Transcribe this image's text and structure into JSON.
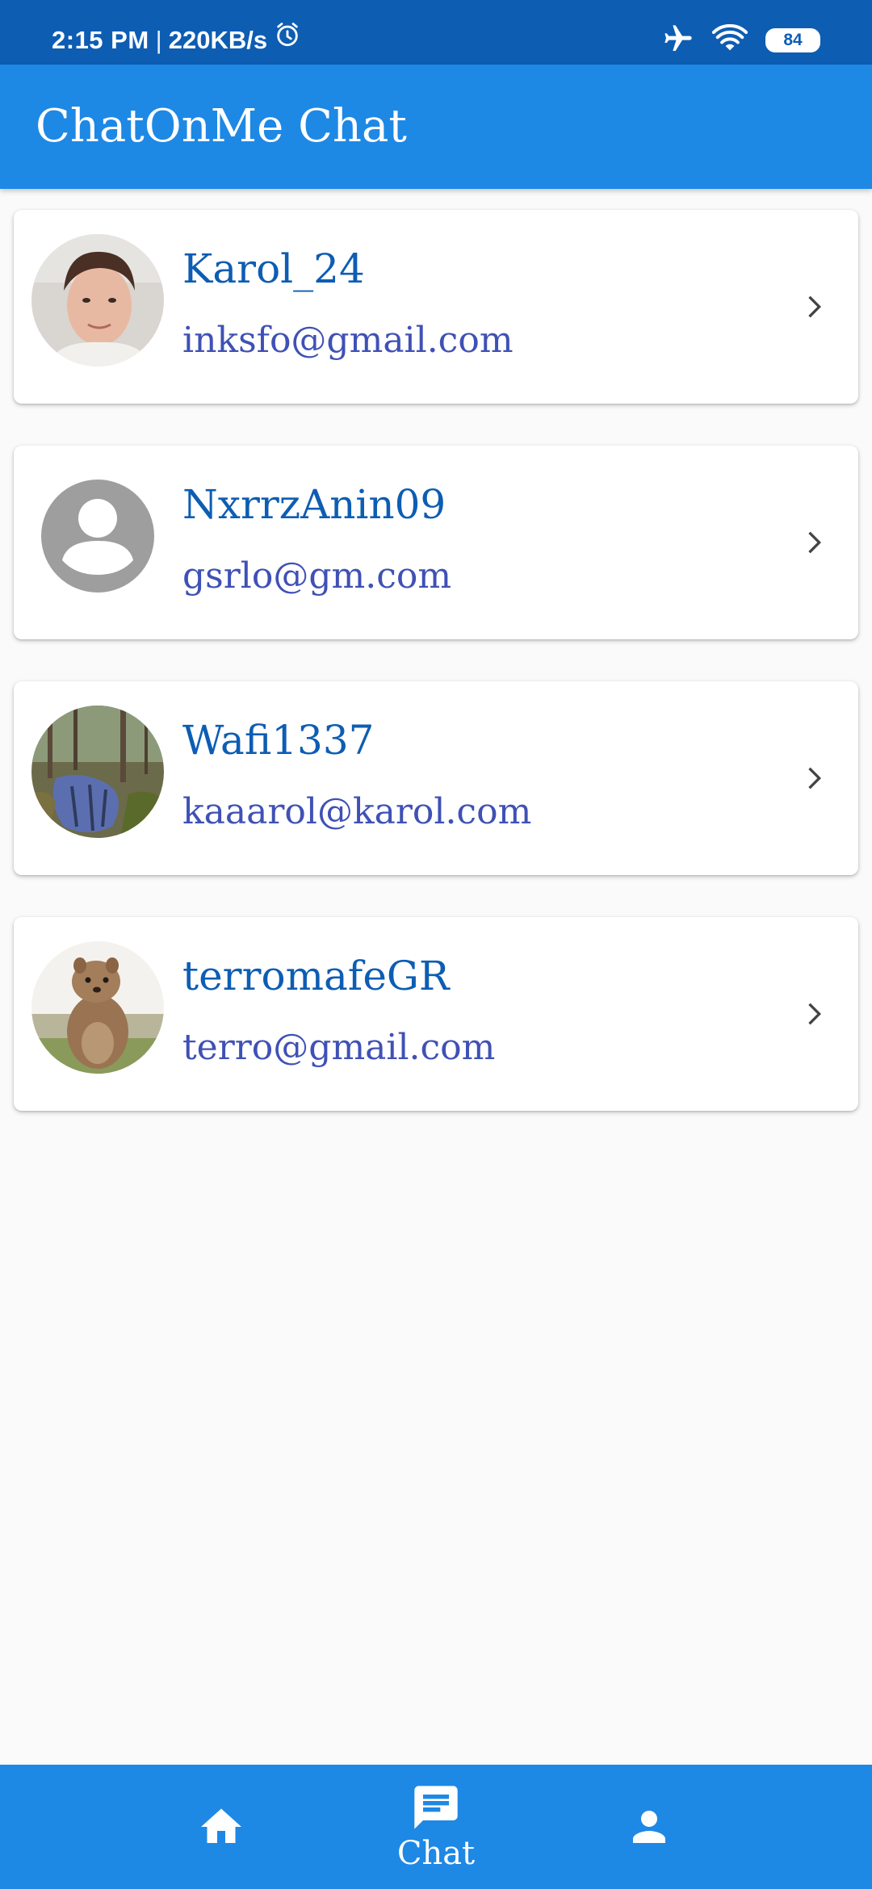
{
  "status_bar": {
    "time": "2:15 PM",
    "separator": "|",
    "speed": "220KB/s",
    "battery": "84",
    "icons": [
      "alarm-icon",
      "airplane-icon",
      "wifi-icon",
      "battery-icon"
    ]
  },
  "app_bar": {
    "title": "ChatOnMe Chat"
  },
  "contacts": [
    {
      "name": "Karol_24",
      "email": "inksfo@gmail.com",
      "avatar": "photo-person"
    },
    {
      "name": "NxrrzAnin09",
      "email": "gsrlo@gm.com",
      "avatar": "default-person-icon"
    },
    {
      "name": "Wafi1337",
      "email": "kaaarol@karol.com",
      "avatar": "photo-forest-stream"
    },
    {
      "name": "terromafeGR",
      "email": "terro@gmail.com",
      "avatar": "photo-quokka"
    }
  ],
  "bottom_nav": {
    "items": [
      {
        "icon": "home-icon",
        "label": ""
      },
      {
        "icon": "chat-icon",
        "label": "Chat",
        "active": true
      },
      {
        "icon": "person-icon",
        "label": ""
      }
    ]
  },
  "colors": {
    "status_bar": "#0d5db3",
    "app_bar": "#1e88e5",
    "name_text": "#0d5db3",
    "email_text": "#3f51b5",
    "background": "#fafafa"
  }
}
